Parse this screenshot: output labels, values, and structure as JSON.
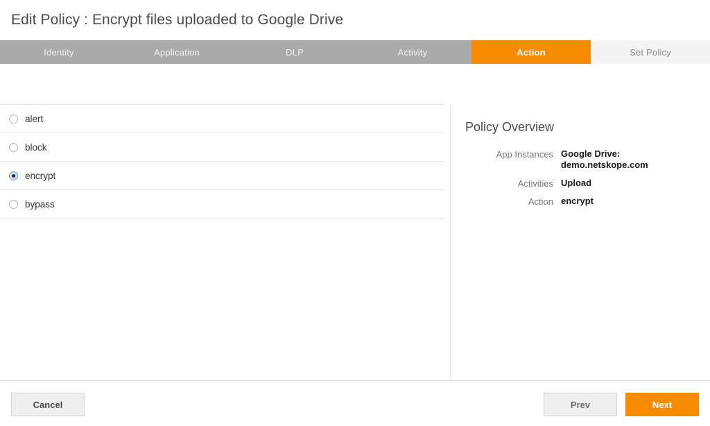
{
  "window": {
    "title": "Edit Policy : Encrypt files uploaded to Google Drive"
  },
  "colors": {
    "accent_orange": "#f68b00",
    "stepbar_gray": "#aaaaaa",
    "step_future_bg": "#f4f4f4",
    "divider": "#e6e6e6"
  },
  "steps": [
    {
      "label": "Identity",
      "state": "done"
    },
    {
      "label": "Application",
      "state": "done"
    },
    {
      "label": "DLP",
      "state": "done"
    },
    {
      "label": "Activity",
      "state": "done"
    },
    {
      "label": "Action",
      "state": "active"
    },
    {
      "label": "Set Policy",
      "state": "future"
    }
  ],
  "action_options": [
    {
      "label": "alert",
      "selected": false
    },
    {
      "label": "block",
      "selected": false
    },
    {
      "label": "encrypt",
      "selected": true
    },
    {
      "label": "bypass",
      "selected": false
    }
  ],
  "overview": {
    "title": "Policy Overview",
    "rows": [
      {
        "label": "App Instances",
        "value": "Google Drive: demo.netskope.com"
      },
      {
        "label": "Activities",
        "value": "Upload"
      },
      {
        "label": "Action",
        "value": "encrypt"
      }
    ]
  },
  "footer": {
    "cancel_label": "Cancel",
    "prev_label": "Prev",
    "next_label": "Next"
  }
}
